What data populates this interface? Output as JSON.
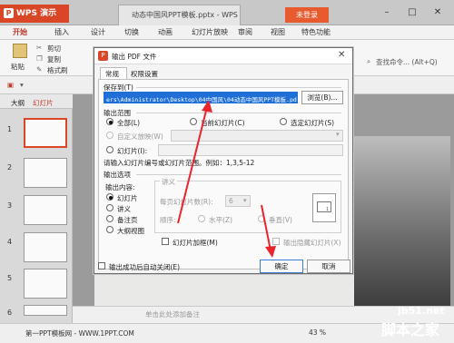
{
  "app": {
    "name": "WPS 演示",
    "doc_title": "动态中国风PPT模板.pptx - WPS 演示",
    "login": "未登录"
  },
  "menu": [
    "开始",
    "插入",
    "设计",
    "切换",
    "动画",
    "幻灯片放映",
    "审阅",
    "视图",
    "特色功能"
  ],
  "ribbon": {
    "paste": "粘贴",
    "cut": "剪切",
    "copy": "复制",
    "format_painter": "格式刷",
    "search_hint": "查找命令... (Alt+Q)"
  },
  "left_pane": {
    "tab_outline": "大纲",
    "tab_slides": "幻灯片",
    "slide_numbers": [
      "1",
      "2",
      "3",
      "4",
      "5",
      "6"
    ]
  },
  "notes_placeholder": "单击此处添加备注",
  "status": {
    "left": "第一PPT模板网 - WWW.1PPT.COM",
    "zoom": "43 %"
  },
  "dialog": {
    "title": "输出 PDF 文件",
    "tabs": [
      "常规",
      "权限设置"
    ],
    "save_to_label": "保存到(T)",
    "save_path": "ers\\Administrator\\Desktop\\04中国风\\04动态中国风PPT模板.pdf",
    "browse": "浏览(B)...",
    "range_label": "输出范围",
    "range_all": "全部(L)",
    "range_current": "当前幻灯片(C)",
    "range_selected": "选定幻灯片(S)",
    "range_custom": "自定义放映(W)",
    "range_slides": "幻灯片(I):",
    "range_hint": "请输入幻灯片编号或幻灯片范围。例如：1,3,5-12",
    "options_label": "输出选项",
    "content_label": "输出内容:",
    "content_slides": "幻灯片",
    "content_handouts": "讲义",
    "content_notes": "备注页",
    "content_outline": "大纲视图",
    "handout_label": "讲义",
    "per_page_label": "每页幻灯片数(R):",
    "per_page_value": "6",
    "order_label": "顺序:",
    "order_horizontal": "水平(Z)",
    "order_vertical": "垂直(V)",
    "preview_number": "1",
    "frame_slides": "幻灯片加框(M)",
    "hidden_slides": "输出隐藏幻灯片(X)",
    "close_after": "输出成功后自动关闭(E)",
    "ok": "确定",
    "cancel": "取消"
  },
  "watermark": {
    "line1": "jb51.net",
    "line2": "脚本之家"
  },
  "colors": {
    "accent": "#d94727",
    "dialog_bg": "#f4f4f4",
    "annotation_red": "#e8242c"
  }
}
